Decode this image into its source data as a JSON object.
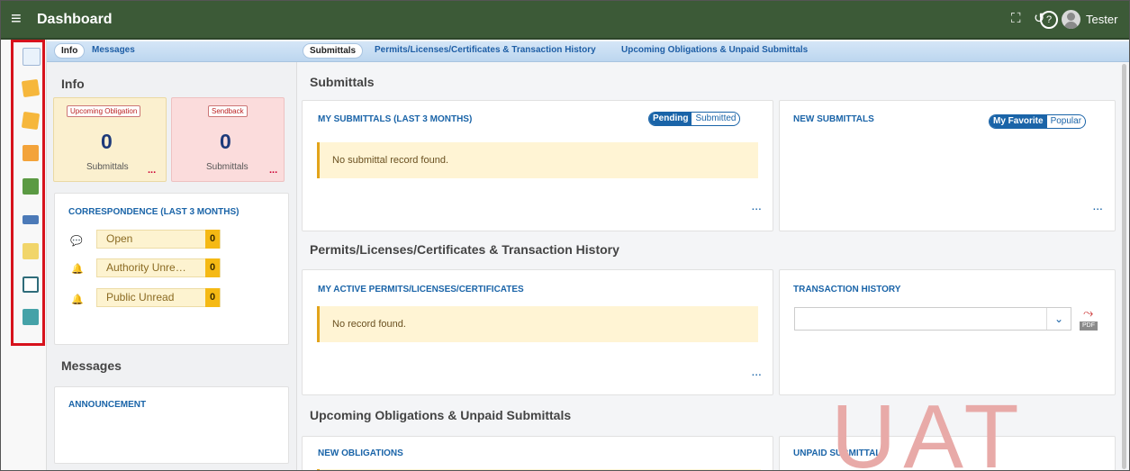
{
  "header": {
    "title": "Dashboard",
    "user": "Tester"
  },
  "left_tabs": [
    "Info",
    "Messages"
  ],
  "right_tabs": [
    "Submittals",
    "Permits/Licenses/Certificates & Transaction History",
    "Upcoming Obligations & Unpaid Submittals"
  ],
  "info": {
    "title": "Info",
    "upcoming": {
      "label": "Upcoming Obligation",
      "count": "0",
      "sub": "Submittals",
      "more": "..."
    },
    "sendback": {
      "label": "Sendback",
      "count": "0",
      "sub": "Submittals",
      "more": "..."
    },
    "correspondence": {
      "title": "CORRESPONDENCE (LAST 3 MONTHS)",
      "items": [
        {
          "label": "Open",
          "count": "0"
        },
        {
          "label": "Authority Unre…",
          "count": "0"
        },
        {
          "label": "Public Unread",
          "count": "0"
        }
      ]
    }
  },
  "messages": {
    "title": "Messages",
    "announcement": "ANNOUNCEMENT"
  },
  "submittals": {
    "title": "Submittals",
    "my": {
      "title": "MY SUBMITTALS (LAST 3 MONTHS)",
      "toggle_on": "Pending",
      "toggle_off": "Submitted",
      "empty": "No submittal record found.",
      "more": "..."
    },
    "new": {
      "title": "NEW SUBMITTALS",
      "toggle_on": "My Favorite",
      "toggle_off": "Popular",
      "more": "..."
    }
  },
  "permits": {
    "title": "Permits/Licenses/Certificates & Transaction History",
    "active": {
      "title": "MY ACTIVE PERMITS/LICENSES/CERTIFICATES",
      "empty": "No record found.",
      "more": "..."
    },
    "transactions": {
      "title": "TRANSACTION HISTORY",
      "pdf": "PDF"
    }
  },
  "obligations": {
    "title": "Upcoming Obligations & Unpaid Submittals",
    "new": "NEW OBLIGATIONS",
    "unpaid": "UNPAID SUBMITTALS"
  },
  "watermark": "UAT",
  "icons": [
    "hamburger-icon",
    "fullscreen-icon",
    "history-icon",
    "help-icon",
    "chevron-down-icon",
    "pdf-icon",
    "chat-icon",
    "bell-icon"
  ],
  "colors": {
    "header": "#3c5a37",
    "link": "#1a64a8",
    "badge": "#f5b914",
    "empty_bg": "#fff4d4",
    "highlight": "#d7121c"
  }
}
